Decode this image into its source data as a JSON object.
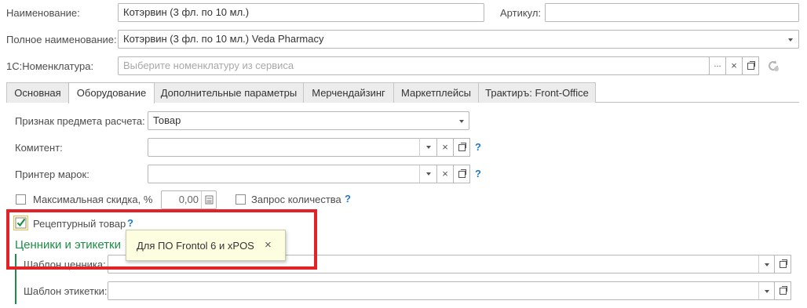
{
  "header": {
    "name_label": "Наименование:",
    "name_value": "Котэрвин (3 фл. по 10 мл.)",
    "article_label": "Артикул:",
    "article_value": "",
    "fullname_label": "Полное наименование:",
    "fullname_value": "Котэрвин (3 фл. по 10 мл.) Veda Pharmacy",
    "nomenclature_label": "1С:Номенклатура:",
    "nomenclature_placeholder": "Выберите номенклатуру из сервиса",
    "dots_label": "...",
    "clear_label": "×"
  },
  "tabs": [
    {
      "label": "Основная",
      "active": false
    },
    {
      "label": "Оборудование",
      "active": true
    },
    {
      "label": "Дополнительные параметры",
      "active": false
    },
    {
      "label": "Мерчендайзинг",
      "active": false
    },
    {
      "label": "Маркетплейсы",
      "active": false
    },
    {
      "label": "Трактиръ: Front-Office",
      "active": false
    }
  ],
  "equipment": {
    "payment_subject_label": "Признак предмета расчета:",
    "payment_subject_value": "Товар",
    "committent_label": "Комитент:",
    "committent_value": "",
    "printer_label": "Принтер марок:",
    "printer_value": "",
    "max_discount_label": "Максимальная скидка, %",
    "max_discount_value": "0,00",
    "max_discount_checked": false,
    "quantity_request_label": "Запрос количества",
    "quantity_request_checked": false,
    "prescription_label": "Рецептурный товар",
    "prescription_checked": true,
    "help_mark": "?",
    "clear_label": "×"
  },
  "tooltip": {
    "text": "Для ПО Frontol 6 и xPOS",
    "close_label": "×"
  },
  "labels_section": {
    "title": "Ценники и этикетки",
    "price_tag_label": "Шаблон ценника:",
    "price_tag_value": "",
    "label_template_label": "Шаблон этикетки:",
    "label_template_value": ""
  },
  "colors": {
    "highlight_frame": "#e32228",
    "section_green": "#1c8f45",
    "tooltip_bg": "#fdfde0",
    "help_blue": "#1f78c8"
  }
}
